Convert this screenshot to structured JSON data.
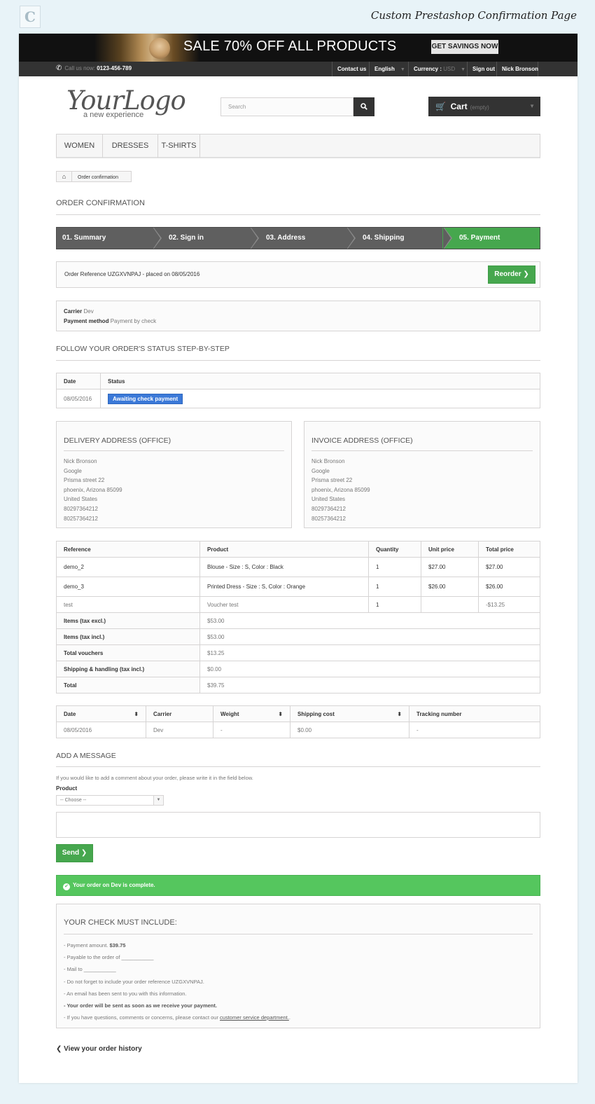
{
  "page_caption": "Custom Prestashop Confirmation Page",
  "banner": {
    "text": "SALE 70% OFF ALL PRODUCTS",
    "button": "GET SAVINGS NOW"
  },
  "topnav": {
    "call_label": "Call us now:",
    "phone": "0123-456-789",
    "contact": "Contact us",
    "language": "English",
    "currency_label": "Currency :",
    "currency_value": "USD",
    "signout": "Sign out",
    "user": "Nick Bronson"
  },
  "logo": {
    "main": "YourLogo",
    "sub": "a new experience"
  },
  "search": {
    "placeholder": "Search"
  },
  "cart": {
    "label": "Cart",
    "status": "(empty)"
  },
  "menu": [
    "WOMEN",
    "DRESSES",
    "T-SHIRTS"
  ],
  "breadcrumb": {
    "current": "Order confirmation"
  },
  "page_title": "ORDER CONFIRMATION",
  "steps": [
    "01. Summary",
    "02. Sign in",
    "03. Address",
    "04. Shipping",
    "05. Payment"
  ],
  "order": {
    "reference_line": "Order Reference UZGXVNPAJ - placed on 08/05/2016",
    "reorder": "Reorder",
    "carrier_label": "Carrier",
    "carrier_value": "Dev",
    "payment_label": "Payment method",
    "payment_value": "Payment by check"
  },
  "status_section": {
    "title": "FOLLOW YOUR ORDER'S STATUS STEP-BY-STEP",
    "headers": [
      "Date",
      "Status"
    ],
    "date": "08/05/2016",
    "status": "Awaiting check payment"
  },
  "delivery": {
    "title": "DELIVERY ADDRESS (OFFICE)",
    "lines": [
      "Nick Bronson",
      "Google",
      "Prisma street 22",
      "phoenix, Arizona 85099",
      "United States",
      "80297364212",
      "80257364212"
    ]
  },
  "invoice": {
    "title": "INVOICE ADDRESS (OFFICE)",
    "lines": [
      "Nick Bronson",
      "Google",
      "Prisma street 22",
      "phoenix, Arizona 85099",
      "United States",
      "80297364212",
      "80257364212"
    ]
  },
  "products": {
    "headers": [
      "Reference",
      "Product",
      "Quantity",
      "Unit price",
      "Total price"
    ],
    "rows": [
      [
        "demo_2",
        "Blouse - Size : S, Color : Black",
        "1",
        "$27.00",
        "$27.00"
      ],
      [
        "demo_3",
        "Printed Dress - Size : S, Color : Orange",
        "1",
        "$26.00",
        "$26.00"
      ],
      [
        "test",
        "Voucher test",
        "1",
        "",
        "-$13.25"
      ]
    ],
    "totals": [
      [
        "Items (tax excl.)",
        "$53.00"
      ],
      [
        "Items (tax incl.)",
        "$53.00"
      ],
      [
        "Total vouchers",
        "$13.25"
      ],
      [
        "Shipping & handling (tax incl.)",
        "$0.00"
      ],
      [
        "Total",
        "$39.75"
      ]
    ]
  },
  "shipping": {
    "headers": [
      "Date",
      "Carrier",
      "Weight",
      "Shipping cost",
      "Tracking number"
    ],
    "row": [
      "08/05/2016",
      "Dev",
      "-",
      "$0.00",
      "-"
    ]
  },
  "message": {
    "title": "ADD A MESSAGE",
    "intro": "If you would like to add a comment about your order, please write it in the field below.",
    "product_label": "Product",
    "select_value": "-- Choose --",
    "send": "Send"
  },
  "alert": "Your order on Dev is complete.",
  "check": {
    "title": "YOUR CHECK MUST INCLUDE:",
    "amount_prefix": "- Payment amount.",
    "amount_value": "$39.75",
    "payable": "- Payable to the order of ___________",
    "mail": "- Mail to ___________",
    "ref_note": "- Do not forget to include your order reference UZGXVNPAJ.",
    "email_note": "- An email has been sent to you with this information.",
    "sent_note": "- Your order will be sent as soon as we receive your payment.",
    "questions_prefix": "- If you have questions, comments or concerns, please contact our",
    "questions_link": "customer service department.",
    "questions_suffix": "."
  },
  "history_link": "View your order history"
}
